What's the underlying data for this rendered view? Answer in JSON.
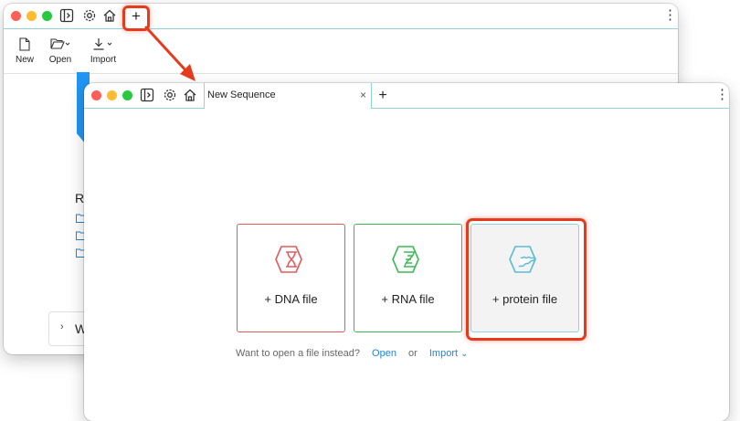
{
  "back_window": {
    "toolbar": {
      "new_label": "New",
      "open_label": "Open",
      "import_label": "Import"
    },
    "recent_label": "R",
    "panel_text": "W"
  },
  "front_window": {
    "tab_title": "New Sequence",
    "cards": {
      "dna": {
        "label": "+ DNA file",
        "color": "#e05a5e"
      },
      "rna": {
        "label": "+ RNA file",
        "color": "#3dba55"
      },
      "protein": {
        "label": "+ protein file",
        "color": "#5bbcd6"
      }
    },
    "open_prompt": "Want to open a file instead?",
    "open_link": "Open",
    "or_text": "or",
    "import_link": "Import"
  },
  "icons": {
    "plus": "+",
    "close": "×",
    "more": "⋮",
    "chevron_right": "›",
    "chevron_down": "⌄"
  },
  "annotation_color": "#e53a1c"
}
